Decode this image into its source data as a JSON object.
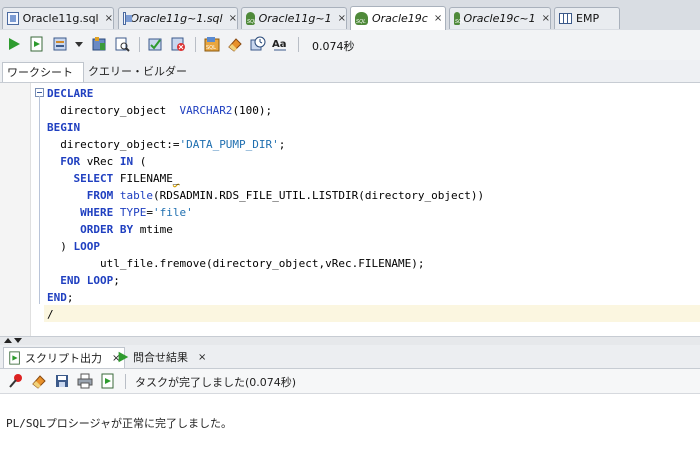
{
  "doc_tabs": [
    {
      "label": "Oracle11g.sql",
      "icon": "sql-file-icon",
      "italic": false
    },
    {
      "label": "Oracle11g~1.sql",
      "icon": "sql-file-icon",
      "italic": true
    },
    {
      "label": "Oracle11g~1",
      "icon": "sql-connection-icon",
      "italic": true
    },
    {
      "label": "Oracle19c",
      "icon": "sql-connection-icon",
      "italic": true,
      "active": true
    },
    {
      "label": "Oracle19c~1",
      "icon": "sql-connection-icon",
      "italic": true
    },
    {
      "label": "EMP",
      "icon": "table-icon",
      "italic": false
    }
  ],
  "close_glyph": "×",
  "toolbar": {
    "elapsed": "0.074秒"
  },
  "subtabs": {
    "worksheet": "ワークシート",
    "query_builder": "クエリー・ビルダー"
  },
  "code": [
    [
      {
        "t": "DECLARE",
        "c": "kw"
      }
    ],
    [
      {
        "t": "  directory_object  "
      },
      {
        "t": "VARCHAR2",
        "c": "typ"
      },
      {
        "t": "(100);"
      }
    ],
    [
      {
        "t": "BEGIN",
        "c": "kw"
      }
    ],
    [
      {
        "t": "  directory_object:="
      },
      {
        "t": "'DATA_PUMP_DIR'",
        "c": "str"
      },
      {
        "t": ";"
      }
    ],
    [
      {
        "t": "  "
      },
      {
        "t": "FOR",
        "c": "kw"
      },
      {
        "t": " vRec "
      },
      {
        "t": "IN",
        "c": "kw"
      },
      {
        "t": " ("
      }
    ],
    [
      {
        "t": "    "
      },
      {
        "t": "SELECT",
        "c": "kw"
      },
      {
        "t": " FILENAME"
      },
      {
        "t": "_",
        "c": "squig"
      }
    ],
    [
      {
        "t": "      "
      },
      {
        "t": "FROM",
        "c": "kw"
      },
      {
        "t": " "
      },
      {
        "t": "table",
        "c": "typ"
      },
      {
        "t": "(RDSADMIN.RDS_FILE_UTIL.LISTDIR(directory_object))"
      }
    ],
    [
      {
        "t": "     "
      },
      {
        "t": "WHERE",
        "c": "kw"
      },
      {
        "t": " "
      },
      {
        "t": "TYPE",
        "c": "typ"
      },
      {
        "t": "="
      },
      {
        "t": "'file'",
        "c": "str"
      }
    ],
    [
      {
        "t": "     "
      },
      {
        "t": "ORDER BY",
        "c": "kw"
      },
      {
        "t": " mtime"
      }
    ],
    [
      {
        "t": "  ) "
      },
      {
        "t": "LOOP",
        "c": "kw"
      }
    ],
    [
      {
        "t": "        utl_file.fremove(directory_object,vRec.FILENAME);"
      }
    ],
    [
      {
        "t": "  "
      },
      {
        "t": "END LOOP",
        "c": "kw"
      },
      {
        "t": ";"
      }
    ],
    [
      {
        "t": "END",
        "c": "kw"
      },
      {
        "t": ";"
      }
    ],
    [
      {
        "t": "/"
      }
    ]
  ],
  "bottom_tabs": {
    "script_output": "スクリプト出力",
    "query_result": "問合せ結果"
  },
  "bottom_toolbar": {
    "status": "タスクが完了しました(0.074秒)"
  },
  "output": {
    "text": "PL/SQLプロシージャが正常に完了しました。"
  },
  "colors": {
    "keyword": "#1f3fc0",
    "string": "#1f6fb0",
    "run": "#2e9b2e"
  }
}
